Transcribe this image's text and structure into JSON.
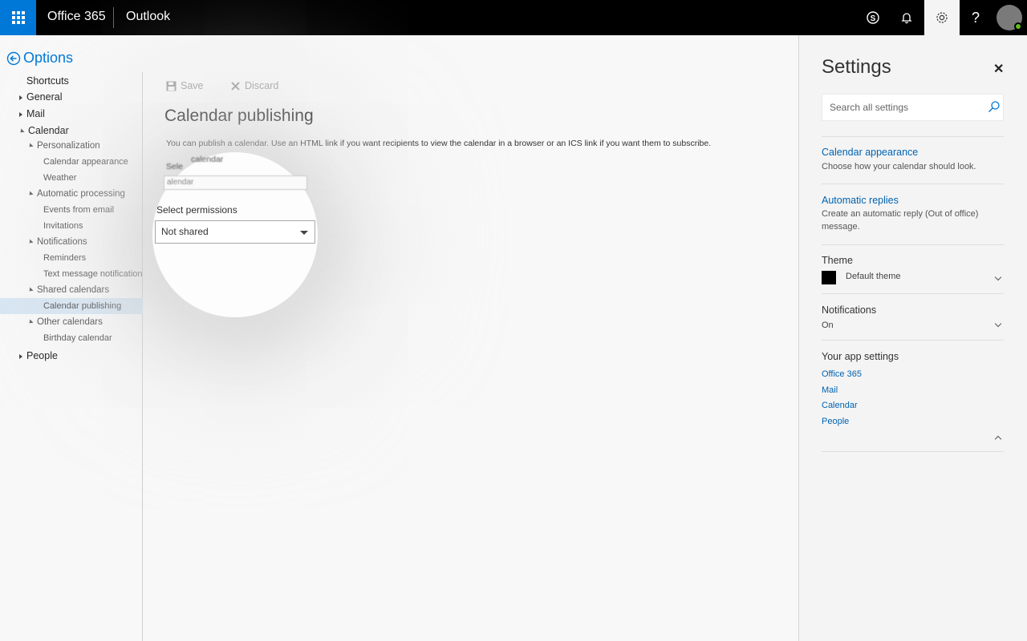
{
  "topbar": {
    "brand": "Office 365",
    "app": "Outlook"
  },
  "leftnav": {
    "back_label": "Options",
    "items": [
      {
        "label": "Shortcuts",
        "level": 0
      },
      {
        "label": "General",
        "level": 0
      },
      {
        "label": "Mail",
        "level": 0
      },
      {
        "label": "Calendar",
        "level": 0
      },
      {
        "label": "Personalization",
        "level": 1
      },
      {
        "label": "Calendar appearance",
        "level": 2
      },
      {
        "label": "Weather",
        "level": 2
      },
      {
        "label": "Automatic processing",
        "level": 1
      },
      {
        "label": "Events from email",
        "level": 2
      },
      {
        "label": "Invitations",
        "level": 2
      },
      {
        "label": "Notifications",
        "level": 1
      },
      {
        "label": "Reminders",
        "level": 2
      },
      {
        "label": "Text message notifications",
        "level": 2
      },
      {
        "label": "Shared calendars",
        "level": 1
      },
      {
        "label": "Calendar publishing",
        "level": 2,
        "selected": true
      },
      {
        "label": "Other calendars",
        "level": 1
      },
      {
        "label": "Birthday calendar",
        "level": 2
      },
      {
        "label": "People",
        "level": 0
      }
    ]
  },
  "main": {
    "save_label": "Save",
    "discard_label": "Discard",
    "title": "Calendar publishing",
    "description": "You can publish a calendar. Use an HTML link if you want recipients to view the calendar in a browser or an ICS link if you want them to subscribe.",
    "select_calendar_label_partial": "Sele",
    "select_calendar_overlay_text": "calendar",
    "select_calendar_value_partial": "alendar",
    "permissions_label": "Select permissions",
    "permissions_value": "Not shared"
  },
  "settings": {
    "title": "Settings",
    "search_placeholder": "Search all settings",
    "calendar_appearance": {
      "link": "Calendar appearance",
      "desc": "Choose how your calendar should look."
    },
    "automatic_replies": {
      "link": "Automatic replies",
      "desc": "Create an automatic reply (Out of office) message."
    },
    "theme": {
      "heading": "Theme",
      "value": "Default theme",
      "swatch_color": "#000000"
    },
    "notifications": {
      "heading": "Notifications",
      "value": "On"
    },
    "app_settings": {
      "heading": "Your app settings",
      "links": [
        "Office 365",
        "Mail",
        "Calendar",
        "People"
      ]
    }
  },
  "colors": {
    "accent": "#0078d7",
    "link": "#0063b1",
    "topbar": "#000000",
    "selected_nav": "#d8e6f3",
    "presence": "#5dc21e"
  }
}
